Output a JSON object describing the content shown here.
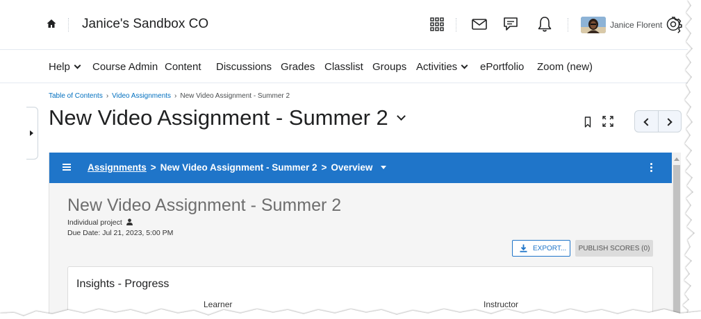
{
  "header": {
    "org_title": "Janice's Sandbox CO",
    "user_name": "Janice Florent"
  },
  "nav": {
    "items": [
      "Help",
      "Course Admin",
      "Content",
      "Discussions",
      "Grades",
      "Classlist",
      "Groups",
      "Activities",
      "ePortfolio",
      "Zoom (new)"
    ]
  },
  "breadcrumb": {
    "items": [
      "Table of Contents",
      "Video Assignments"
    ],
    "current": "New Video Assignment - Summer 2"
  },
  "topic": {
    "title": "New Video Assignment - Summer 2"
  },
  "tool": {
    "crumb_root": "Assignments",
    "crumb_assignment": "New Video Assignment - Summer 2",
    "crumb_page": "Overview",
    "assignment_title": "New Video Assignment - Summer 2",
    "assignment_type": "Individual project",
    "due_date": "Due Date: Jul 21, 2023, 5:00 PM",
    "export_label": "EXPORT...",
    "publish_label": "PUBLISH SCORES (0)",
    "insights_title": "Insights - Progress",
    "col_learner": "Learner",
    "col_instructor": "Instructor"
  },
  "colors": {
    "tool_bar": "#1f75c9",
    "link": "#006fbf"
  }
}
